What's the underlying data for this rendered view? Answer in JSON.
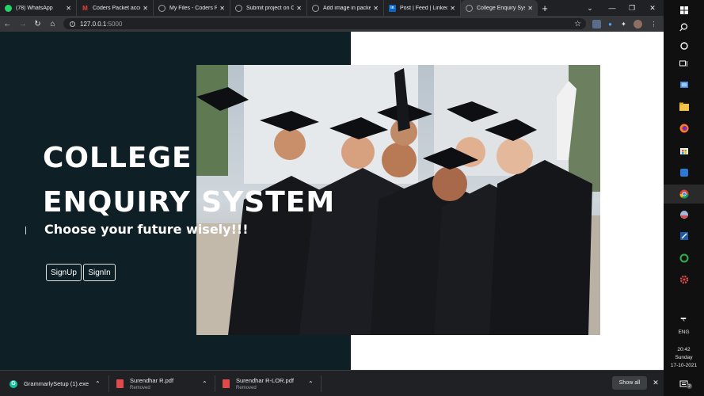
{
  "browser": {
    "tabs": [
      {
        "title": "(78) WhatsApp",
        "icon": "whatsapp-icon",
        "color": "#25d366"
      },
      {
        "title": "Coders Packet acco",
        "icon": "gmail-icon",
        "color": "#ea4335"
      },
      {
        "title": "My Files - Coders P",
        "icon": "globe-icon",
        "color": "#9aa0a6"
      },
      {
        "title": "Submit project on C",
        "icon": "globe-icon",
        "color": "#9aa0a6"
      },
      {
        "title": "Add image in packe",
        "icon": "globe-icon",
        "color": "#9aa0a6"
      },
      {
        "title": "Post | Feed | Linked",
        "icon": "linkedin-icon",
        "color": "#0a66c2"
      },
      {
        "title": "College Enquiry Sys",
        "icon": "globe-icon",
        "color": "#9aa0a6",
        "active": true
      }
    ],
    "new_tab": "+",
    "window_controls": {
      "dropdown": "⌄",
      "minimize": "—",
      "restore": "❐",
      "close": "✕"
    },
    "nav": {
      "back": "←",
      "forward": "→",
      "reload": "↻",
      "home": "⌂"
    },
    "url_host": "127.0.0.1",
    "url_port": ":5000",
    "bookmark_star": "☆",
    "menu": "⋮"
  },
  "page": {
    "title_line1": "COLLEGE",
    "title_line2": "ENQUIRY SYSTEM",
    "subtitle": "Choose your future wisely!!!",
    "signup_label": "SignUp",
    "signin_label": "SignIn",
    "colors": {
      "dark_panel": "#0f1f26",
      "background": "#ffffff"
    }
  },
  "downloads": {
    "items": [
      {
        "name": "GrammarlySetup (1).exe",
        "status": "",
        "icon": "grammarly-icon",
        "color": "#15c39a"
      },
      {
        "name": "Surendhar R.pdf",
        "status": "Removed",
        "icon": "pdf-icon",
        "color": "#e04a4a"
      },
      {
        "name": "Surendhar R-LOR.pdf",
        "status": "Removed",
        "icon": "pdf-icon",
        "color": "#e04a4a"
      }
    ],
    "show_all": "Show all",
    "close": "✕"
  },
  "taskbar": {
    "language": "ENG",
    "time": "20:42",
    "day": "Sunday",
    "date": "17-10-2021",
    "notification_count": "2"
  }
}
